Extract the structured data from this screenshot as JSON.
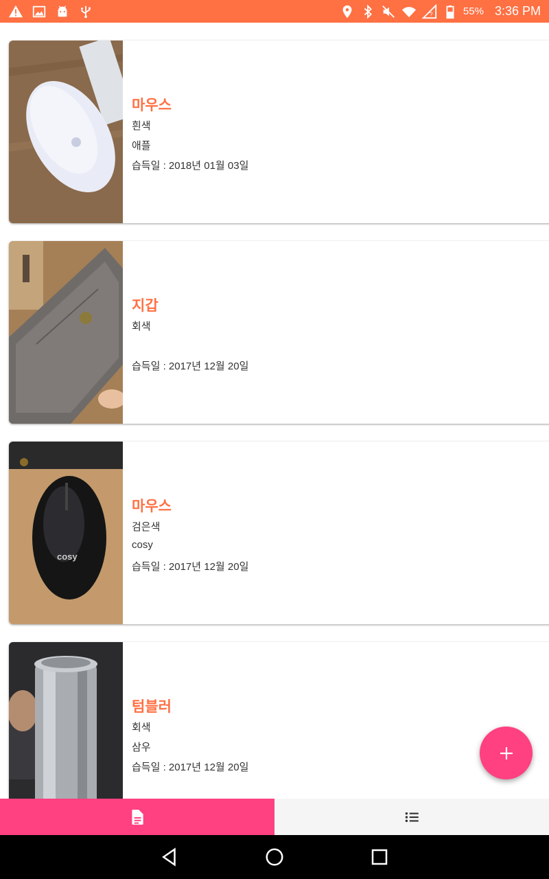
{
  "status_bar": {
    "battery_text": "55%",
    "time": "3:36 PM",
    "icons_left": [
      "warning-icon",
      "image-icon",
      "android-icon",
      "usb-icon"
    ],
    "icons_right": [
      "location-icon",
      "bluetooth-icon",
      "mute-icon",
      "wifi-icon",
      "signal-icon",
      "battery-icon"
    ],
    "background": "#ff7043"
  },
  "items": [
    {
      "name": "마우스",
      "color": "흰색",
      "brand": "애플",
      "acquired": "습득일 : 2018년 01월 03일"
    },
    {
      "name": "지갑",
      "color": "회색",
      "brand": "",
      "acquired": "습득일 : 2017년 12월 20일"
    },
    {
      "name": "마우스",
      "color": "검은색",
      "brand": "cosy",
      "acquired": "습득일 : 2017년 12월 20일"
    },
    {
      "name": "텀블러",
      "color": "회색",
      "brand": "삼우",
      "acquired": "습득일 : 2017년 12월 20일"
    }
  ],
  "fab": {
    "icon": "plus-icon",
    "color": "#ff4081"
  },
  "tabs": [
    {
      "icon": "document-icon",
      "active": true
    },
    {
      "icon": "list-icon",
      "active": false
    }
  ],
  "colors": {
    "accent": "#ff4081",
    "title": "#ff7043"
  },
  "navbar": {
    "icons": [
      "back-icon",
      "home-icon",
      "recents-icon"
    ]
  }
}
